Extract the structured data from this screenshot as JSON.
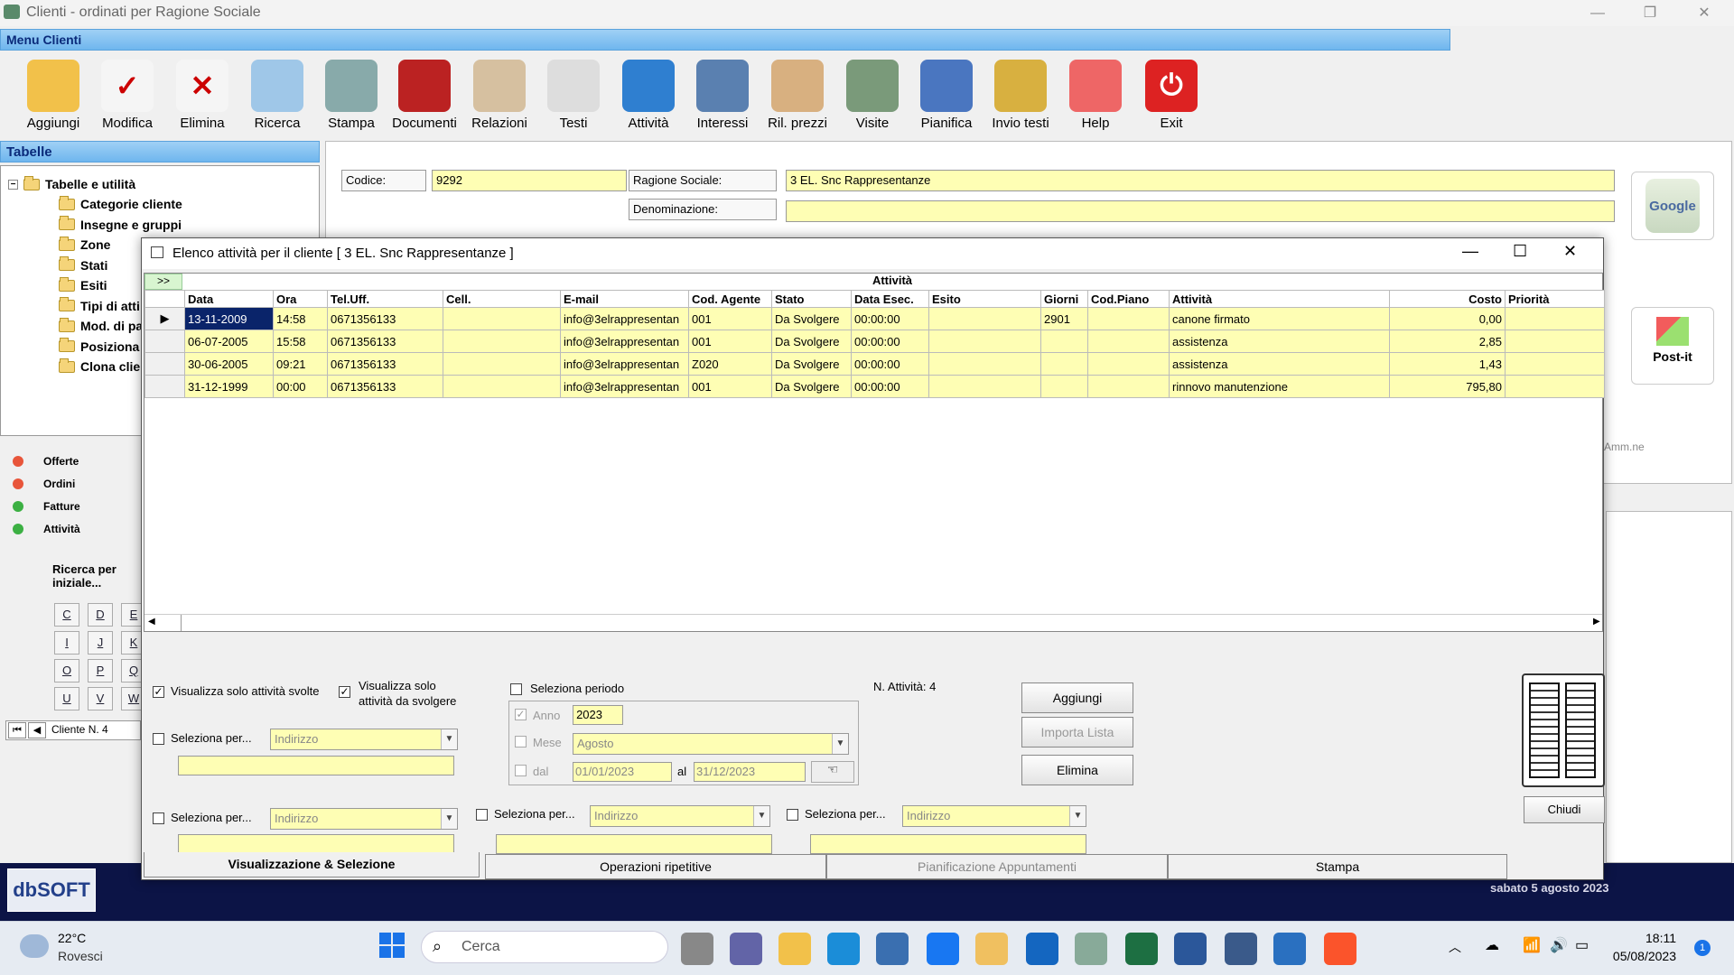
{
  "window": {
    "title": "Clienti - ordinati per Ragione Sociale"
  },
  "menu": {
    "label": "Menu Clienti"
  },
  "toolbar": [
    "Aggiungi",
    "Modifica",
    "Elimina",
    "Ricerca",
    "Stampa",
    "Documenti",
    "Relazioni",
    "Testi",
    "Attività",
    "Interessi",
    "Ril. prezzi",
    "Visite",
    "Pianifica",
    "Invio testi",
    "Help",
    "Exit"
  ],
  "tables": {
    "header": "Tabelle",
    "root": "Tabelle e utilità",
    "items": [
      "Categorie cliente",
      "Insegne e gruppi",
      "Zone",
      "Stati",
      "Esiti",
      "Tipi di atti",
      "Mod. di pa",
      "Posiziona",
      "Clona clie"
    ]
  },
  "legend": [
    {
      "label": "Offerte",
      "color": "#e8553a"
    },
    {
      "label": "Ordini",
      "color": "#e8553a"
    },
    {
      "label": "Fatture",
      "color": "#3cb043"
    },
    {
      "label": "Attività",
      "color": "#3cb043"
    }
  ],
  "search": {
    "label": "Ricerca per iniziale...",
    "letters": [
      "C",
      "D",
      "E",
      "I",
      "J",
      "K",
      "O",
      "P",
      "Q",
      "U",
      "V",
      "W"
    ]
  },
  "nav": {
    "record": "Cliente N. 4"
  },
  "client": {
    "codice_label": "Codice:",
    "codice": "9292",
    "ragione_label": "Ragione Sociale:",
    "ragione": "3 EL. Snc Rappresentanze",
    "denom_label": "Denominazione:",
    "denom": "",
    "amm": "Amm.ne"
  },
  "side": {
    "postit": "Post-it",
    "google": "Google"
  },
  "dialog": {
    "title": "Elenco attività per il cliente [ 3 EL. Snc Rappresentanze ]",
    "expand": ">>",
    "group": "Attività",
    "columns": [
      "Data",
      "Ora",
      "Tel.Uff.",
      "Cell.",
      "E-mail",
      "Cod. Agente",
      "Stato",
      "Data Esec.",
      "Esito",
      "Giorni",
      "Cod.Piano",
      "Attività",
      "Costo",
      "Priorità"
    ],
    "rows": [
      [
        "13-11-2009",
        "14:58",
        "0671356133",
        "",
        "info@3elrappresentan",
        "001",
        "Da Svolgere",
        "00:00:00",
        "",
        "2901",
        "",
        "canone firmato",
        "0,00",
        ""
      ],
      [
        "06-07-2005",
        "15:58",
        "0671356133",
        "",
        "info@3elrappresentan",
        "001",
        "Da Svolgere",
        "00:00:00",
        "",
        "",
        "",
        "assistenza",
        "2,85",
        ""
      ],
      [
        "30-06-2005",
        "09:21",
        "0671356133",
        "",
        "info@3elrappresentan",
        "Z020",
        "Da Svolgere",
        "00:00:00",
        "",
        "",
        "",
        "assistenza",
        "1,43",
        ""
      ],
      [
        "31-12-1999",
        "00:00",
        "0671356133",
        "",
        "info@3elrappresentan",
        "001",
        "Da Svolgere",
        "00:00:00",
        "",
        "",
        "",
        "rinnovo manutenzione",
        "795,80",
        ""
      ]
    ],
    "filters": {
      "svolte": "Visualizza solo attività svolte",
      "da_svolgere": "Visualizza solo attività da svolgere",
      "periodo": "Seleziona periodo",
      "count": "N. Attività: 4",
      "sel": "Seleziona per...",
      "indirizzo": "Indirizzo",
      "anno_label": "Anno",
      "anno": "2023",
      "mese_label": "Mese",
      "mese": "Agosto",
      "dal_label": "dal",
      "dal": "01/01/2023",
      "al_label": "al",
      "al": "31/12/2023"
    },
    "buttons": {
      "aggiungi": "Aggiungi",
      "importa": "Importa Lista",
      "elimina": "Elimina",
      "chiudi": "Chiudi"
    },
    "tabs": [
      "Visualizzazione & Selezione",
      "Operazioni ripetitive",
      "Pianificazione Appuntamenti",
      "Stampa"
    ]
  },
  "status": {
    "logo": "dbSOFT",
    "date": "sabato 5 agosto 2023"
  },
  "taskbar": {
    "temp": "22°C",
    "weather": "Rovesci",
    "search": "Cerca",
    "time": "18:11",
    "date": "05/08/2023",
    "badge": "1"
  }
}
